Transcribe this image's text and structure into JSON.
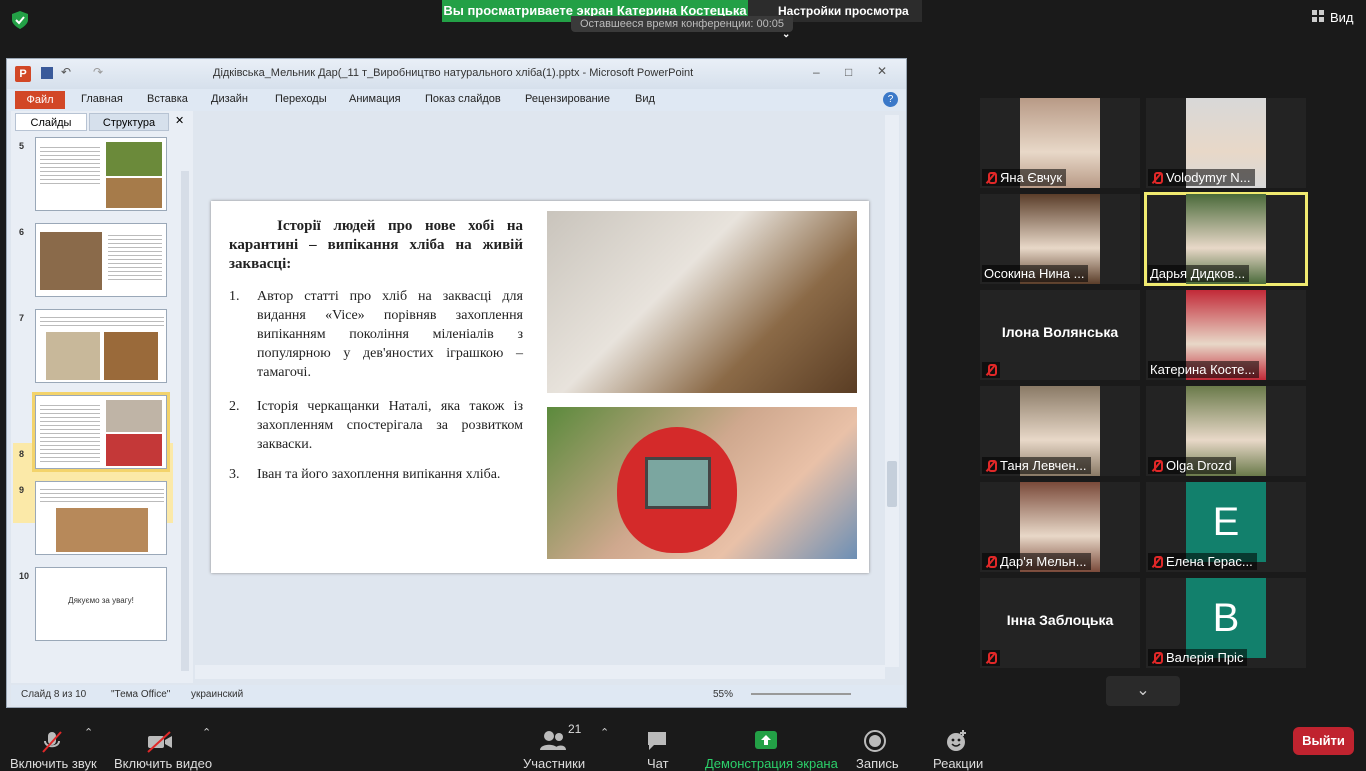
{
  "zoom_meeting": {
    "banner_text": "Вы просматриваете экран Катерина Костецька",
    "view_options_label": "Настройки просмотра",
    "timer_text": "Оставшееся время конференции: 00:05",
    "view_label": "Вид",
    "leave_label": "Выйти"
  },
  "ppt": {
    "window_title": "Дідківська_Мельник Дар(_11 т_Виробництво натурального хліба(1).pptx - Microsoft PowerPoint",
    "menu": [
      "Файл",
      "Главная",
      "Вставка",
      "Дизайн",
      "Переходы",
      "Анимация",
      "Показ слайдов",
      "Рецензирование",
      "Вид"
    ],
    "pane_tabs": [
      "Слайды",
      "Структура"
    ],
    "slide_numbers": [
      "5",
      "6",
      "7",
      "8",
      "9",
      "10"
    ],
    "slide10_text": "Дякуємо за увагу!",
    "slide": {
      "title": "Історії людей про нове хобі на карантині – випікання хліба на живій заквасці:",
      "items": [
        {
          "n": "1.",
          "text": "Автор статті про хліб на заквасці для видання «Vice» порівняв захоплення випіканням покоління міленіалів з популярною у дев'яностих іграшкою –тамагочі."
        },
        {
          "n": "2.",
          "text": "Історія черкащанки Наталі, яка також із захопленням спостерігала за розвитком закваски."
        },
        {
          "n": "3.",
          "text": "Іван та його захоплення випікання хліба."
        }
      ]
    },
    "status": {
      "slide_info": "Слайд 8 из 10",
      "theme": "\"Тема Office\"",
      "language": "украинский",
      "zoom": "55%"
    }
  },
  "participants": [
    {
      "name": "Яна Євчук",
      "muted": true,
      "video": true,
      "color": "#b89a86"
    },
    {
      "name": "Volodymyr N...",
      "muted": true,
      "video": true,
      "color": "#d8d8d8"
    },
    {
      "name": "Осокина Нина ...",
      "muted": false,
      "video": true,
      "color": "#5b3e2a"
    },
    {
      "name": "Дарья Дидков...",
      "muted": false,
      "video": true,
      "color": "#4a6a3a",
      "active": true
    },
    {
      "name": "Ілона Волянська",
      "muted": true,
      "video": false
    },
    {
      "name": "Катерина Косте...",
      "muted": false,
      "video": true,
      "color": "#c22a38"
    },
    {
      "name": "Таня Левчен...",
      "muted": true,
      "video": true,
      "color": "#8a7a66"
    },
    {
      "name": "Olga Drozd",
      "muted": true,
      "video": true,
      "color": "#6a7a4a"
    },
    {
      "name": "Дар'я Мельн...",
      "muted": true,
      "video": true,
      "color": "#7a4a3a"
    },
    {
      "name": "Елена Герас...",
      "muted": true,
      "video": false,
      "letter": "E"
    },
    {
      "name": "Інна Заблоцька",
      "muted": true,
      "video": false
    },
    {
      "name": "Валерія Пріс",
      "muted": true,
      "video": false,
      "letter": "B"
    }
  ],
  "toolbar": {
    "mute_label": "Включить звук",
    "video_label": "Включить видео",
    "participants_label": "Участники",
    "participants_count": "21",
    "chat_label": "Чат",
    "share_label": "Демонстрация экрана",
    "record_label": "Запись",
    "reactions_label": "Реакции"
  }
}
